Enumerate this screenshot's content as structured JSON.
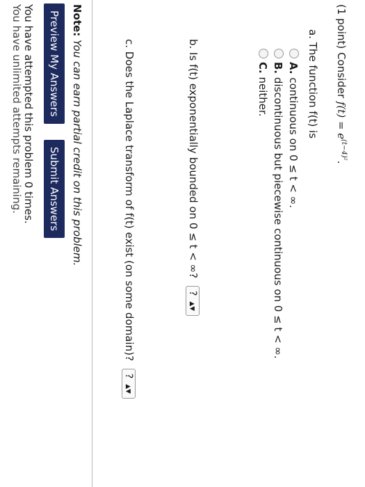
{
  "problem": {
    "points": "(1 point)",
    "consider_text": "Consider",
    "function_def": "f(t) = e",
    "exponent": "(t−4)²",
    "part_a": {
      "prompt": "a. The function f(t) is",
      "choices": [
        {
          "letter": "A.",
          "text": "continuous on 0 ≤ t < ∞."
        },
        {
          "letter": "B.",
          "text": "discontinuous but piecewise continuous on 0 ≤ t < ∞."
        },
        {
          "letter": "C.",
          "text": "neither."
        }
      ]
    },
    "part_b": {
      "prompt": "b. Is f(t) exponentially bounded on 0 ≤ t < ∞?",
      "select_value": "?"
    },
    "part_c": {
      "prompt": "c. Does the Laplace transform of f(t) exist (on some domain)?",
      "select_value": "?"
    }
  },
  "note": {
    "label": "Note:",
    "text": "You can earn partial credit on this problem."
  },
  "buttons": {
    "preview": "Preview My Answers",
    "submit": "Submit Answers"
  },
  "status": {
    "attempts": "You have attempted this problem 0 times.",
    "remaining": "You have unlimited attempts remaining."
  },
  "colors": {
    "button_bg": "#1d2a5e",
    "button_text": "#ffffff"
  }
}
